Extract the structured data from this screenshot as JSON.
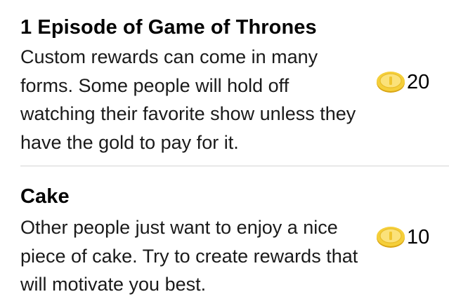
{
  "rewards": [
    {
      "title": "1 Episode of Game of Thrones",
      "description": "Custom rewards can come in many forms. Some people will hold off watching their favorite show unless they have the gold to pay for it.",
      "cost": "20",
      "cost_icon": "gold-coin-icon"
    },
    {
      "title": "Cake",
      "description": "Other people just want to enjoy a nice piece of cake. Try to create rewards that will motivate you best.",
      "cost": "10",
      "cost_icon": "gold-coin-icon"
    }
  ],
  "colors": {
    "coin_fill": "#f5cf3a",
    "coin_rim": "#e3b21c",
    "separator": "#d4d4d4"
  }
}
